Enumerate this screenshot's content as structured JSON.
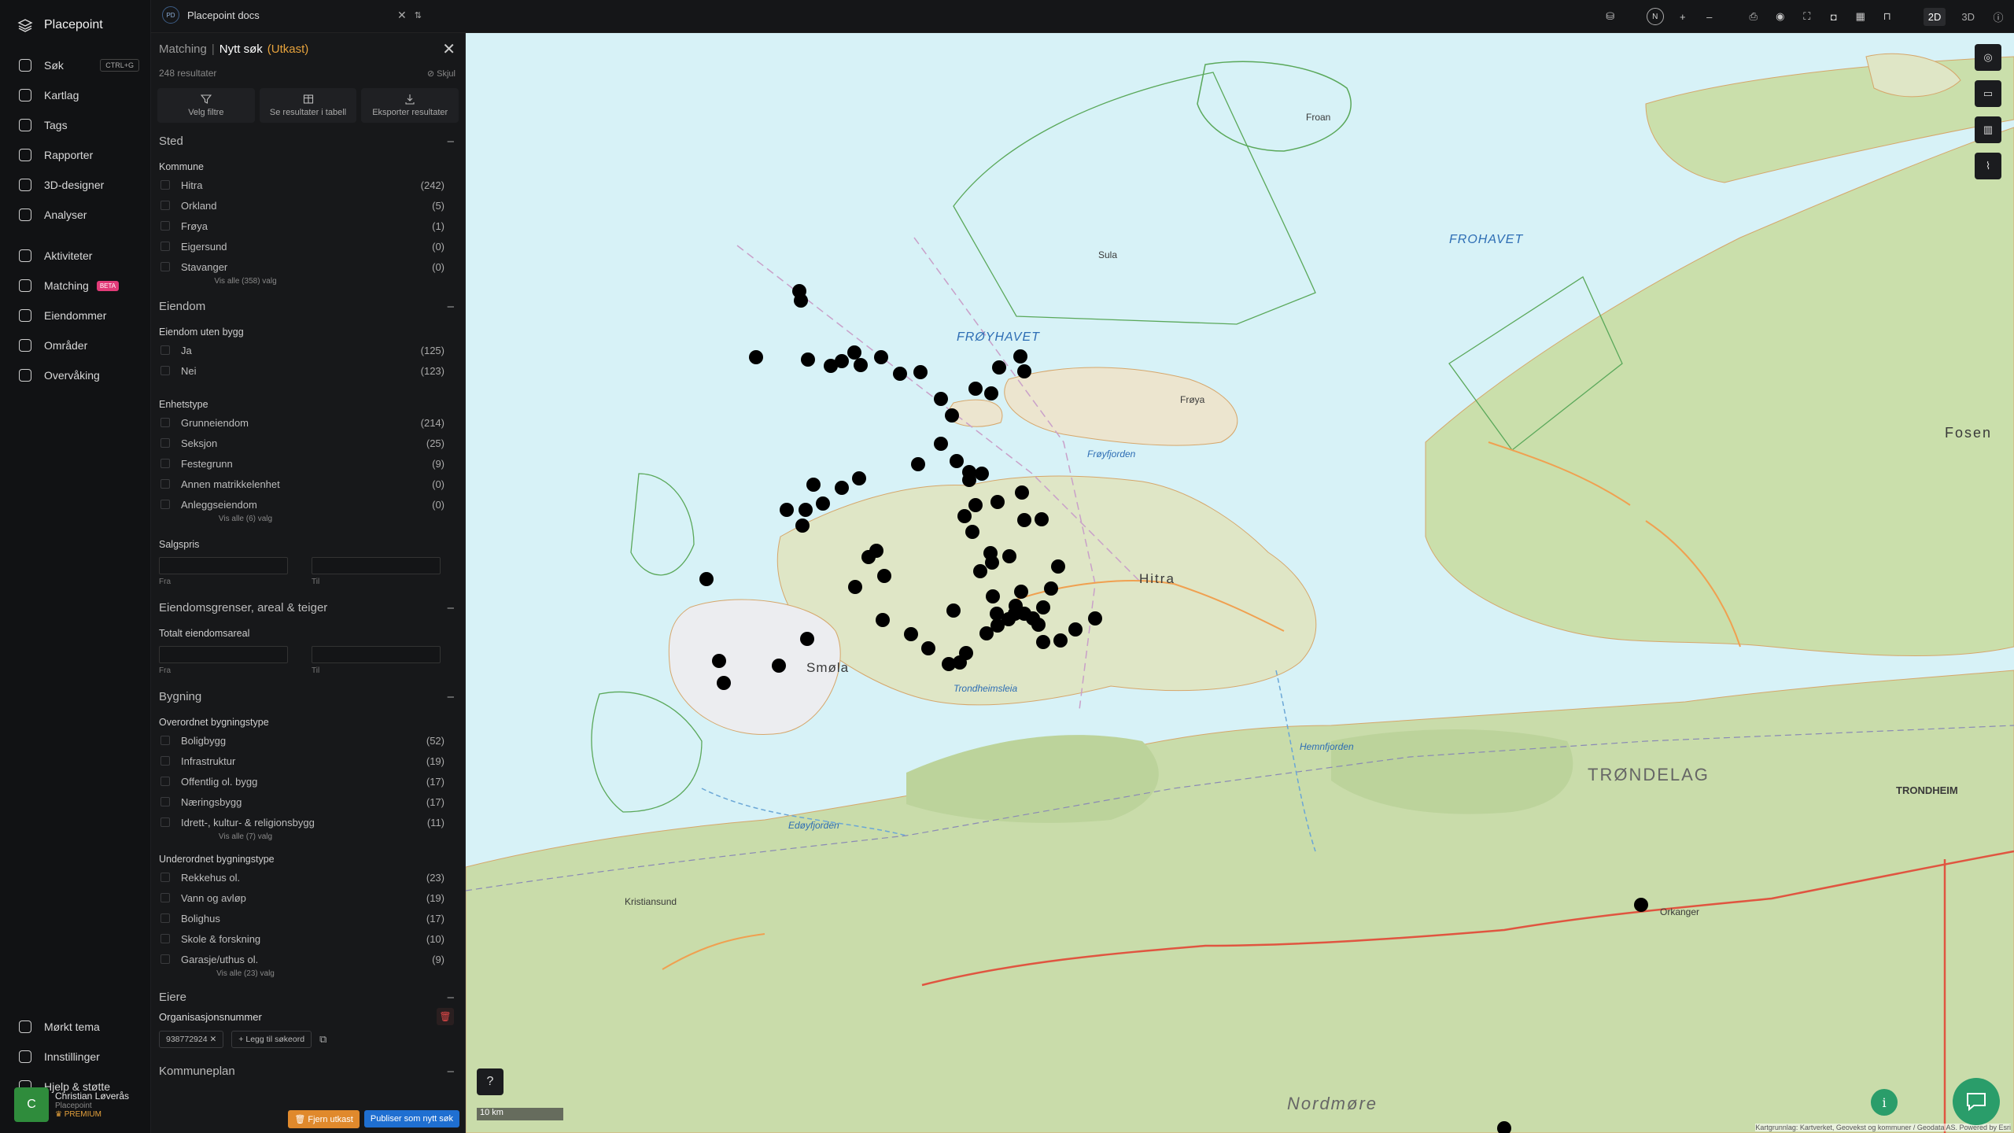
{
  "brand": {
    "name": "Placepoint"
  },
  "nav": {
    "items": [
      {
        "key": "sok",
        "label": "Søk",
        "icon": "search-icon",
        "shortcut": "CTRL+G"
      },
      {
        "key": "kartlag",
        "label": "Kartlag",
        "icon": "layers-icon"
      },
      {
        "key": "tags",
        "label": "Tags",
        "icon": "bookmark-icon"
      },
      {
        "key": "rapporter",
        "label": "Rapporter",
        "icon": "bar-chart-icon"
      },
      {
        "key": "designer",
        "label": "3D-designer",
        "icon": "cube-icon"
      },
      {
        "key": "analyser",
        "label": "Analyser",
        "icon": "bolt-icon"
      }
    ],
    "items2": [
      {
        "key": "aktiviteter",
        "label": "Aktiviteter",
        "icon": "message-icon"
      },
      {
        "key": "matching",
        "label": "Matching",
        "icon": "match-search-icon",
        "badge": "BETA"
      },
      {
        "key": "eiendommer",
        "label": "Eiendommer",
        "icon": "building-icon"
      },
      {
        "key": "omrader",
        "label": "Områder",
        "icon": "area-icon"
      },
      {
        "key": "overvaking",
        "label": "Overvåking",
        "icon": "monitor-icon"
      }
    ],
    "bottom": [
      {
        "key": "theme",
        "label": "Mørkt tema",
        "icon": "moon-icon"
      },
      {
        "key": "settings",
        "label": "Innstillinger",
        "icon": "gear-icon"
      },
      {
        "key": "help",
        "label": "Hjelp & støtte",
        "icon": "help-icon"
      }
    ]
  },
  "user": {
    "initial": "C",
    "name": "Christian Løverås",
    "org": "Placepoint",
    "plan": "PREMIUM"
  },
  "topbar": {
    "workspace_badge": "PD",
    "workspace": "Placepoint docs",
    "mode_2d": "2D",
    "mode_3d": "3D",
    "compass": "N"
  },
  "panel": {
    "crumb": "Matching",
    "sep": "|",
    "title": "Nytt søk",
    "draft": "(Utkast)",
    "results": "248 resultater",
    "hide": "Skjul",
    "actions": {
      "filters": "Velg filtre",
      "table": "Se resultater i tabell",
      "export": "Eksporter resultater"
    },
    "sted": {
      "title": "Sted",
      "kommune": "Kommune",
      "rows": [
        {
          "label": "Hitra",
          "count": "(242)"
        },
        {
          "label": "Orkland",
          "count": "(5)"
        },
        {
          "label": "Frøya",
          "count": "(1)"
        },
        {
          "label": "Eigersund",
          "count": "(0)"
        },
        {
          "label": "Stavanger",
          "count": "(0)"
        }
      ],
      "more": "Vis alle (358) valg"
    },
    "eiendom": {
      "title": "Eiendom",
      "uten": "Eiendom uten bygg",
      "rows": [
        {
          "label": "Ja",
          "count": "(125)"
        },
        {
          "label": "Nei",
          "count": "(123)"
        }
      ],
      "enhet": "Enhetstype",
      "enhet_rows": [
        {
          "label": "Grunneiendom",
          "count": "(214)"
        },
        {
          "label": "Seksjon",
          "count": "(25)"
        },
        {
          "label": "Festegrunn",
          "count": "(9)"
        },
        {
          "label": "Annen matrikkelenhet",
          "count": "(0)"
        },
        {
          "label": "Anleggseiendom",
          "count": "(0)"
        }
      ],
      "enhet_more": "Vis alle (6) valg",
      "salgspris": "Salgspris",
      "from": "Fra",
      "to": "Til"
    },
    "grenser": {
      "title": "Eiendomsgrenser, areal & teiger",
      "areal": "Totalt eiendomsareal",
      "from": "Fra",
      "to": "Til"
    },
    "bygning": {
      "title": "Bygning",
      "over": "Overordnet bygningstype",
      "over_rows": [
        {
          "label": "Boligbygg",
          "count": "(52)"
        },
        {
          "label": "Infrastruktur",
          "count": "(19)"
        },
        {
          "label": "Offentlig ol. bygg",
          "count": "(17)"
        },
        {
          "label": "Næringsbygg",
          "count": "(17)"
        },
        {
          "label": "Idrett-, kultur- & religionsbygg",
          "count": "(11)"
        }
      ],
      "over_more": "Vis alle (7) valg",
      "under": "Underordnet bygningstype",
      "under_rows": [
        {
          "label": "Rekkehus ol.",
          "count": "(23)"
        },
        {
          "label": "Vann og avløp",
          "count": "(19)"
        },
        {
          "label": "Bolighus",
          "count": "(17)"
        },
        {
          "label": "Skole & forskning",
          "count": "(10)"
        },
        {
          "label": "Garasje/uthus ol.",
          "count": "(9)"
        }
      ],
      "under_more": "Vis alle (23) valg"
    },
    "eiere": {
      "title": "Eiere",
      "org": "Organisasjonsnummer",
      "tag": "938772924",
      "add": "Legg til søkeord"
    },
    "kommuneplan": {
      "title": "Kommuneplan"
    },
    "buttons": {
      "remove": "Fjern utkast",
      "publish": "Publiser som nytt søk"
    }
  },
  "map": {
    "labels": {
      "froyhavet": "FRØYHAVET",
      "frohavet": "FROHAVET",
      "trondelag": "TRØNDELAG",
      "hitra": "Hitra",
      "smola": "Smøla",
      "nordmore": "Nordmøre",
      "trondheim": "TRONDHEIM",
      "froya": "Frøya",
      "fosen": "Fosen",
      "trondheimsleia": "Trondheimsleia",
      "froyfjorden": "Frøyfjorden",
      "kristiansund": "Kristiansund",
      "orkanger": "Orkanger",
      "sula": "Sula",
      "froan": "Froan",
      "hemnfjorden": "Hemnfjorden",
      "edoyfjorden": "Edøyfjorden"
    },
    "scale": "10 km",
    "attribution": "Kartgrunnlag: Kartverket, Geovekst og kommuner / Geodata AS. Powered by Esri"
  }
}
